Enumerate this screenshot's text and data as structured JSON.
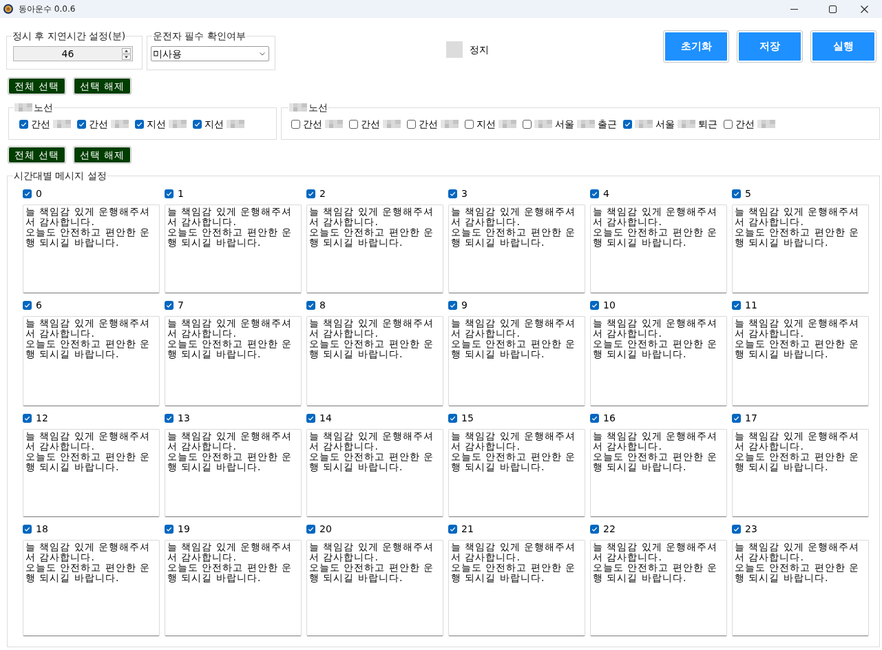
{
  "window": {
    "title": "동아운수 0.0.6"
  },
  "delay_setting": {
    "label": "정시 후 지연시간 설정(분)",
    "value": "46"
  },
  "driver_check": {
    "label": "운전자 필수 확인여부",
    "value": "미사용"
  },
  "status": {
    "label": "정지",
    "active": false
  },
  "action_buttons": [
    "초기화",
    "저장",
    "실행"
  ],
  "route_selection_buttons": [
    "전체 선택",
    "선택 해제"
  ],
  "route_groups": [
    {
      "title": [
        {
          "kind": "blur"
        },
        {
          "kind": "text",
          "text": "노선"
        }
      ],
      "routes": [
        {
          "checked": true,
          "parts": [
            {
              "kind": "text",
              "text": "간선"
            },
            {
              "kind": "blur"
            }
          ]
        },
        {
          "checked": true,
          "parts": [
            {
              "kind": "text",
              "text": "간선"
            },
            {
              "kind": "blur"
            }
          ]
        },
        {
          "checked": true,
          "parts": [
            {
              "kind": "text",
              "text": "지선"
            },
            {
              "kind": "blur"
            }
          ]
        },
        {
          "checked": true,
          "parts": [
            {
              "kind": "text",
              "text": "지선"
            },
            {
              "kind": "blur"
            }
          ]
        }
      ]
    },
    {
      "title": [
        {
          "kind": "blur"
        },
        {
          "kind": "text",
          "text": "노선"
        }
      ],
      "routes": [
        {
          "checked": false,
          "parts": [
            {
              "kind": "text",
              "text": "간선"
            },
            {
              "kind": "blur"
            }
          ]
        },
        {
          "checked": false,
          "parts": [
            {
              "kind": "text",
              "text": "간선"
            },
            {
              "kind": "blur"
            }
          ]
        },
        {
          "checked": false,
          "parts": [
            {
              "kind": "text",
              "text": "간선"
            },
            {
              "kind": "blur"
            }
          ]
        },
        {
          "checked": false,
          "parts": [
            {
              "kind": "text",
              "text": "지선"
            },
            {
              "kind": "blur"
            }
          ]
        },
        {
          "checked": false,
          "parts": [
            {
              "kind": "blur"
            },
            {
              "kind": "text",
              "text": "서울"
            },
            {
              "kind": "blur"
            },
            {
              "kind": "text",
              "text": "출근"
            }
          ]
        },
        {
          "checked": true,
          "parts": [
            {
              "kind": "blur"
            },
            {
              "kind": "text",
              "text": "서울"
            },
            {
              "kind": "blur"
            },
            {
              "kind": "text",
              "text": "퇴근"
            }
          ]
        },
        {
          "checked": false,
          "parts": [
            {
              "kind": "text",
              "text": "간선"
            },
            {
              "kind": "blur"
            }
          ]
        }
      ]
    }
  ],
  "hour_selection_buttons": [
    "전체 선택",
    "선택 해제"
  ],
  "hourly_messages": {
    "label": "시간대별 메시지 설정",
    "hours": [
      {
        "label": "0",
        "checked": true,
        "message": "늘 책임감 있게 운행해주셔서 감사합니다.\n오늘도 안전하고 편안한 운행 되시길 바랍니다."
      },
      {
        "label": "1",
        "checked": true,
        "message": "늘 책임감 있게 운행해주셔서 감사합니다.\n오늘도 안전하고 편안한 운행 되시길 바랍니다."
      },
      {
        "label": "2",
        "checked": true,
        "message": "늘 책임감 있게 운행해주셔서 감사합니다.\n오늘도 안전하고 편안한 운행 되시길 바랍니다."
      },
      {
        "label": "3",
        "checked": true,
        "message": "늘 책임감 있게 운행해주셔서 감사합니다.\n오늘도 안전하고 편안한 운행 되시길 바랍니다."
      },
      {
        "label": "4",
        "checked": true,
        "message": "늘 책임감 있게 운행해주셔서 감사합니다.\n오늘도 안전하고 편안한 운행 되시길 바랍니다."
      },
      {
        "label": "5",
        "checked": true,
        "message": "늘 책임감 있게 운행해주셔서 감사합니다.\n오늘도 안전하고 편안한 운행 되시길 바랍니다."
      },
      {
        "label": "6",
        "checked": true,
        "message": "늘 책임감 있게 운행해주셔서 감사합니다.\n오늘도 안전하고 편안한 운행 되시길 바랍니다."
      },
      {
        "label": "7",
        "checked": true,
        "message": "늘 책임감 있게 운행해주셔서 감사합니다.\n오늘도 안전하고 편안한 운행 되시길 바랍니다."
      },
      {
        "label": "8",
        "checked": true,
        "message": "늘 책임감 있게 운행해주셔서 감사합니다.\n오늘도 안전하고 편안한 운행 되시길 바랍니다."
      },
      {
        "label": "9",
        "checked": true,
        "message": "늘 책임감 있게 운행해주셔서 감사합니다.\n오늘도 안전하고 편안한 운행 되시길 바랍니다."
      },
      {
        "label": "10",
        "checked": true,
        "message": "늘 책임감 있게 운행해주셔서 감사합니다.\n오늘도 안전하고 편안한 운행 되시길 바랍니다."
      },
      {
        "label": "11",
        "checked": true,
        "message": "늘 책임감 있게 운행해주셔서 감사합니다.\n오늘도 안전하고 편안한 운행 되시길 바랍니다."
      },
      {
        "label": "12",
        "checked": true,
        "message": "늘 책임감 있게 운행해주셔서 감사합니다.\n오늘도 안전하고 편안한 운행 되시길 바랍니다."
      },
      {
        "label": "13",
        "checked": true,
        "message": "늘 책임감 있게 운행해주셔서 감사합니다.\n오늘도 안전하고 편안한 운행 되시길 바랍니다."
      },
      {
        "label": "14",
        "checked": true,
        "message": "늘 책임감 있게 운행해주셔서 감사합니다.\n오늘도 안전하고 편안한 운행 되시길 바랍니다."
      },
      {
        "label": "15",
        "checked": true,
        "message": "늘 책임감 있게 운행해주셔서 감사합니다.\n오늘도 안전하고 편안한 운행 되시길 바랍니다."
      },
      {
        "label": "16",
        "checked": true,
        "message": "늘 책임감 있게 운행해주셔서 감사합니다.\n오늘도 안전하고 편안한 운행 되시길 바랍니다."
      },
      {
        "label": "17",
        "checked": true,
        "message": "늘 책임감 있게 운행해주셔서 감사합니다.\n오늘도 안전하고 편안한 운행 되시길 바랍니다."
      },
      {
        "label": "18",
        "checked": true,
        "message": "늘 책임감 있게 운행해주셔서 감사합니다.\n오늘도 안전하고 편안한 운행 되시길 바랍니다."
      },
      {
        "label": "19",
        "checked": true,
        "message": "늘 책임감 있게 운행해주셔서 감사합니다.\n오늘도 안전하고 편안한 운행 되시길 바랍니다."
      },
      {
        "label": "20",
        "checked": true,
        "message": "늘 책임감 있게 운행해주셔서 감사합니다.\n오늘도 안전하고 편안한 운행 되시길 바랍니다."
      },
      {
        "label": "21",
        "checked": true,
        "message": "늘 책임감 있게 운행해주셔서 감사합니다.\n오늘도 안전하고 편안한 운행 되시길 바랍니다."
      },
      {
        "label": "22",
        "checked": true,
        "message": "늘 책임감 있게 운행해주셔서 감사합니다.\n오늘도 안전하고 편안한 운행 되시길 바랍니다."
      },
      {
        "label": "23",
        "checked": true,
        "message": "늘 책임감 있게 운행해주셔서 감사합니다.\n오늘도 안전하고 편안한 운행 되시길 바랍니다."
      }
    ]
  }
}
